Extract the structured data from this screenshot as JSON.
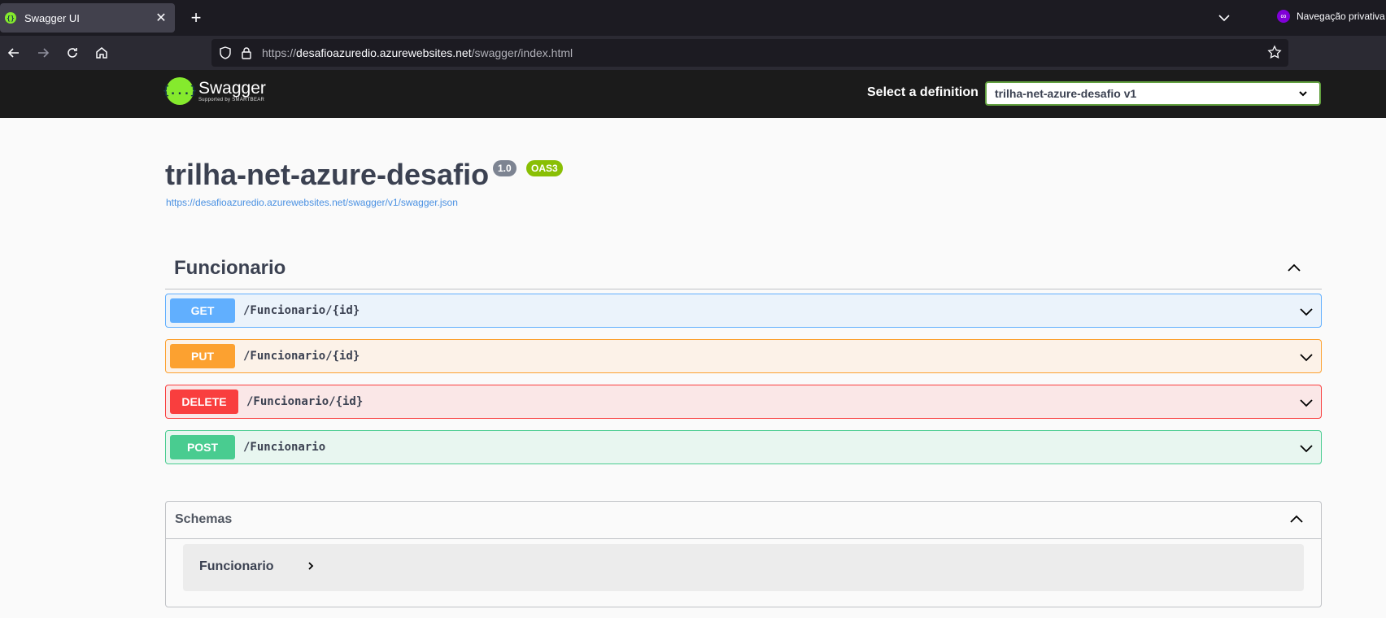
{
  "browser": {
    "tab_title": "Swagger UI",
    "tab_favicon_glyph": "{}",
    "private_label": "Navegação privativa",
    "url_prefix": "https://",
    "url_host": "desafioazuredio.azurewebsites.net",
    "url_path": "/swagger/index.html"
  },
  "topbar": {
    "logo_glyph": "{...}",
    "logo_name": "Swagger",
    "logo_sub": "Supported by SMARTBEAR",
    "select_label": "Select a definition",
    "selected_definition": "trilha-net-azure-desafio v1"
  },
  "info": {
    "title": "trilha-net-azure-desafio",
    "version": "1.0",
    "oas": "OAS3",
    "spec_url": "https://desafioazuredio.azurewebsites.net/swagger/v1/swagger.json"
  },
  "tag": {
    "name": "Funcionario",
    "operations": [
      {
        "method": "GET",
        "path": "/Funcionario/{id}"
      },
      {
        "method": "PUT",
        "path": "/Funcionario/{id}"
      },
      {
        "method": "DELETE",
        "path": "/Funcionario/{id}"
      },
      {
        "method": "POST",
        "path": "/Funcionario"
      }
    ]
  },
  "schemas": {
    "title": "Schemas",
    "models": [
      "Funcionario"
    ]
  },
  "colors": {
    "get": "#61affe",
    "put": "#fca130",
    "delete": "#f93e3e",
    "post": "#49cc90",
    "swagger_green": "#85ea2d"
  }
}
